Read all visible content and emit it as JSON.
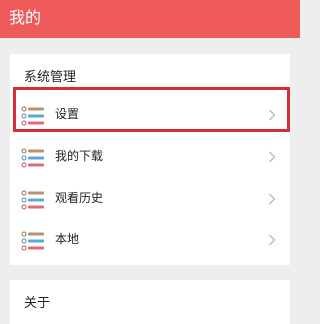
{
  "header": {
    "title": "我的"
  },
  "system_section": {
    "title": "系统管理",
    "items": [
      {
        "label": "设置",
        "icon": "list-icon",
        "chevron": "chevron-right-icon"
      },
      {
        "label": "我的下载",
        "icon": "list-icon",
        "chevron": "chevron-right-icon"
      },
      {
        "label": "观看历史",
        "icon": "list-icon",
        "chevron": "chevron-right-icon"
      },
      {
        "label": "本地",
        "icon": "list-icon",
        "chevron": "chevron-right-icon"
      }
    ]
  },
  "about_section": {
    "title": "关于"
  },
  "colors": {
    "header_bg": "#ef5b5b",
    "highlight": "#d42e38",
    "icon_brown": "#b8926a",
    "icon_blue": "#5aa8d8",
    "icon_red": "#e06a78"
  }
}
